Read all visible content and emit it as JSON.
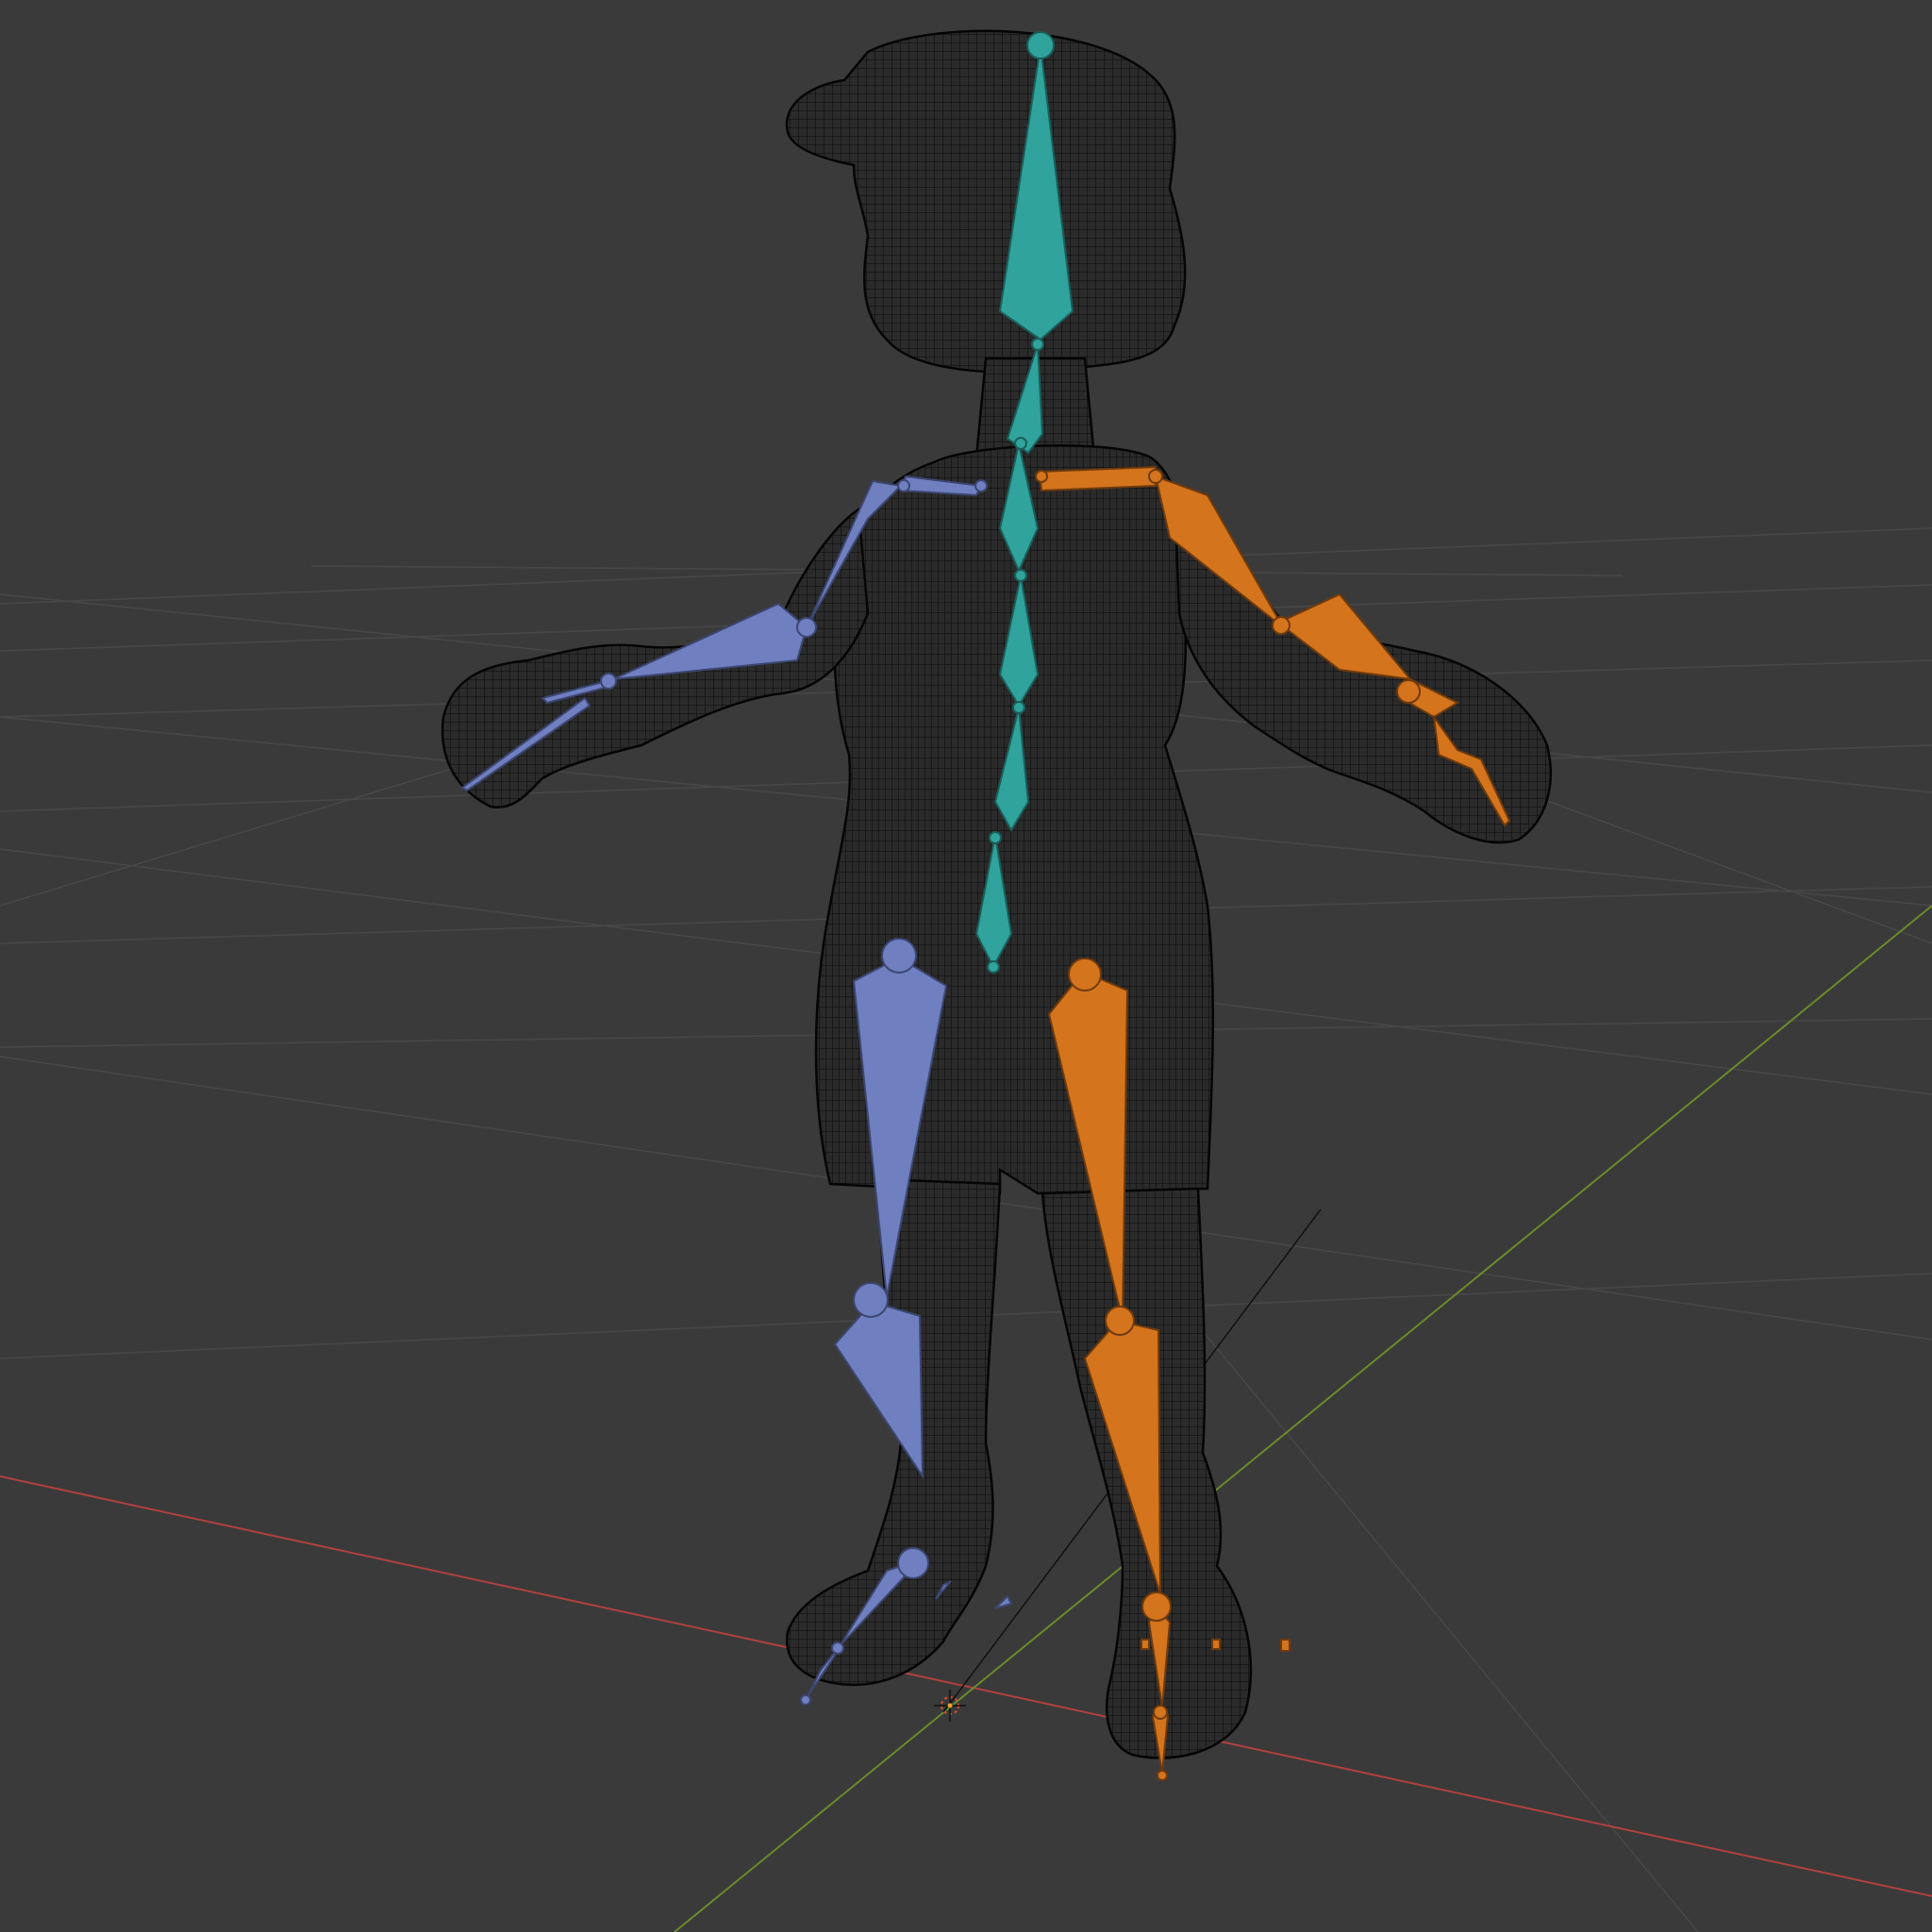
{
  "viewport": {
    "mode": "3d-viewport",
    "shading": "wireframe",
    "background_color": "#3a3a3a",
    "grid_visible": true,
    "grid_color": "#4a4a4a"
  },
  "axes": {
    "x_axis_color": "#b0413e",
    "y_axis_color": "#6b8a2c"
  },
  "mesh": {
    "object": "character-mesh",
    "wire_color": "#0e0e0e",
    "fill_color": "#2c2c2c"
  },
  "armature": {
    "object": "armature",
    "bone_display": "octahedral",
    "colors": {
      "center": "#2fa39c",
      "left_side": "#6f7fc0",
      "right_side": "#d4741d"
    },
    "bone_groups": [
      "spine",
      "head",
      "neck",
      "shoulder-l",
      "upper-arm-l",
      "forearm-l",
      "hand-l",
      "shoulder-r",
      "upper-arm-r",
      "forearm-r",
      "hand-r",
      "thigh-l",
      "shin-l",
      "foot-l",
      "thigh-r",
      "shin-r",
      "foot-r"
    ]
  },
  "icons": {
    "origin": "3d-cursor-icon"
  }
}
